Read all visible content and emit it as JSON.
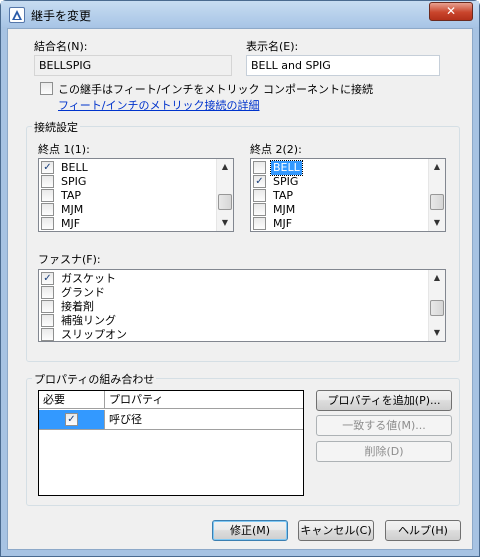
{
  "window": {
    "title": "継手を変更",
    "close_label": "✕"
  },
  "names": {
    "name_label": "結合名(N):",
    "name_value": "BELLSPIG",
    "display_label": "表示名(E):",
    "display_value": "BELL and SPIG"
  },
  "metric": {
    "checkbox_label": "この継手はフィート/インチをメトリック コンポーネントに接続",
    "checked": false,
    "link_text": "フィート/インチのメトリック接続の詳細"
  },
  "connection": {
    "group_title": "接続設定",
    "end1": {
      "label": "終点 1(1):",
      "items": [
        {
          "label": "BELL",
          "checked": true,
          "selected": false
        },
        {
          "label": "SPIG",
          "checked": false,
          "selected": false
        },
        {
          "label": "TAP",
          "checked": false,
          "selected": false
        },
        {
          "label": "MJM",
          "checked": false,
          "selected": false
        },
        {
          "label": "MJF",
          "checked": false,
          "selected": false
        }
      ]
    },
    "end2": {
      "label": "終点 2(2):",
      "items": [
        {
          "label": "BELL",
          "checked": false,
          "selected": true
        },
        {
          "label": "SPIG",
          "checked": true,
          "selected": false
        },
        {
          "label": "TAP",
          "checked": false,
          "selected": false
        },
        {
          "label": "MJM",
          "checked": false,
          "selected": false
        },
        {
          "label": "MJF",
          "checked": false,
          "selected": false
        }
      ]
    },
    "fastener": {
      "label": "ファスナ(F):",
      "items": [
        {
          "label": "ガスケット",
          "checked": true
        },
        {
          "label": "グランド",
          "checked": false
        },
        {
          "label": "接着剤",
          "checked": false
        },
        {
          "label": "補強リング",
          "checked": false
        },
        {
          "label": "スリップオン",
          "checked": false
        }
      ]
    }
  },
  "properties": {
    "group_title": "プロパティの組み合わせ",
    "col_required": "必要",
    "col_property": "プロパティ",
    "rows": [
      {
        "required": true,
        "property": "呼び径"
      }
    ],
    "add_button": "プロパティを追加(P)...",
    "match_button": "一致する値(M)...",
    "delete_button": "削除(D)"
  },
  "footer": {
    "ok_button": "修正(M)",
    "cancel_button": "キャンセル(C)",
    "help_button": "ヘルプ(H)"
  }
}
